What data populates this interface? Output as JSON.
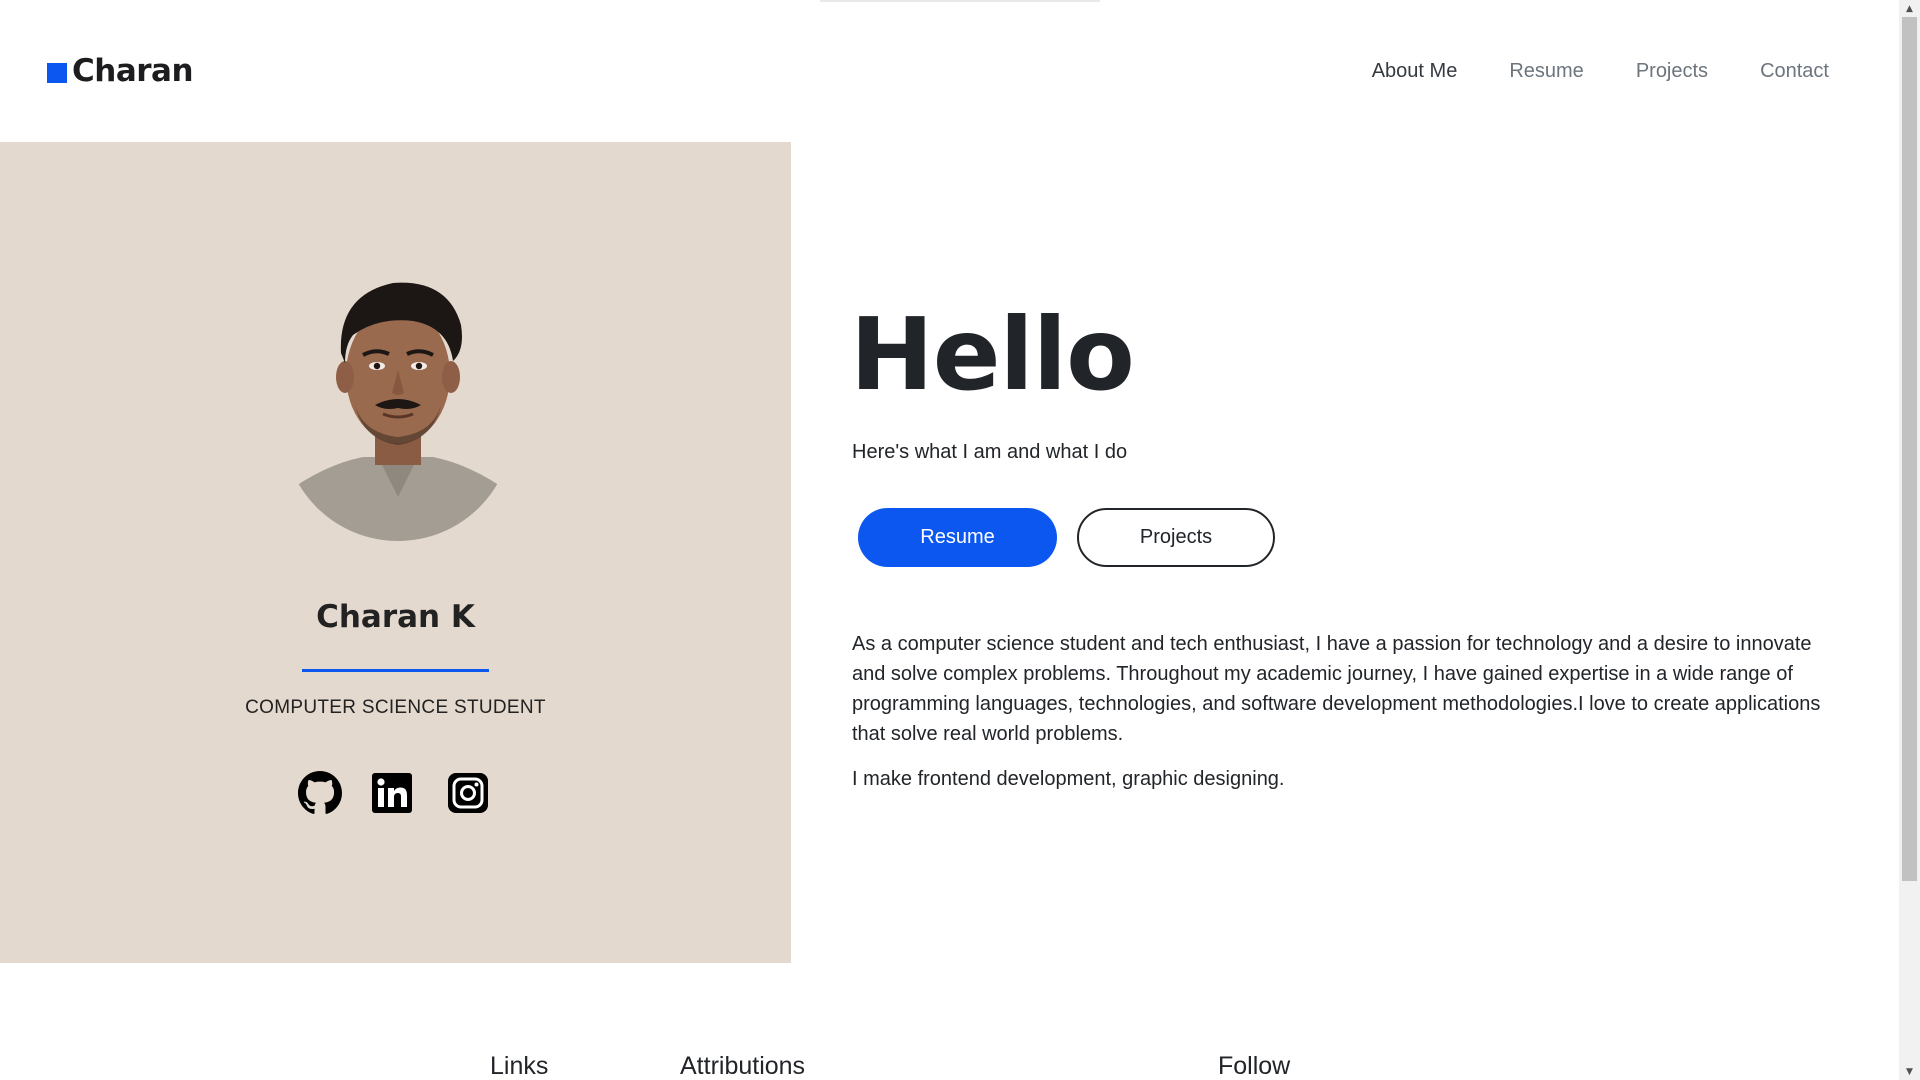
{
  "header": {
    "logo_text": "Charan",
    "nav": [
      "About Me",
      "Resume",
      "Projects",
      "Contact"
    ]
  },
  "profile": {
    "name": "Charan K",
    "role": "COMPUTER SCIENCE STUDENT",
    "socials": [
      "github-icon",
      "linkedin-icon",
      "instagram-icon"
    ]
  },
  "main": {
    "heading": "Hello",
    "subtitle": "Here's what I am and what I do",
    "resume_button": "Resume",
    "projects_button": "Projects",
    "about_paragraph": "As a computer science student and tech enthusiast, I have a passion for technology and a desire to innovate and solve complex problems. Throughout my academic journey, I have gained expertise in a wide range of programming languages, technologies, and software development methodologies.I love to create applications that solve real world problems.",
    "about_line2": "I make frontend development, graphic designing."
  },
  "footer": {
    "links_heading": "Links",
    "attributions_heading": "Attributions",
    "follow_heading": "Follow"
  },
  "colors": {
    "accent": "#0b57f0",
    "profile_bg": "#e4d9ce",
    "text": "#212529"
  }
}
